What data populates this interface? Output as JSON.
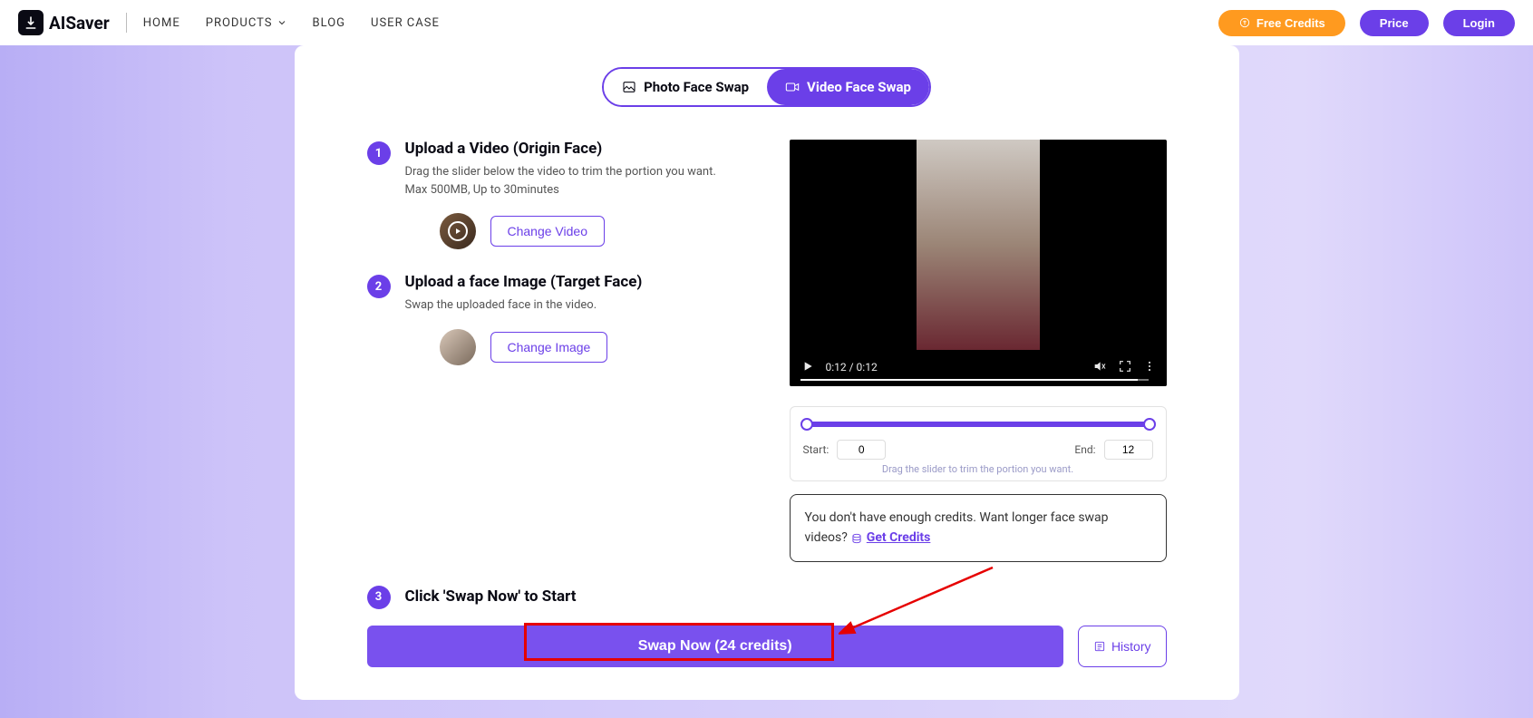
{
  "header": {
    "logo_text": "AISaver",
    "nav": {
      "home": "HOME",
      "products": "PRODUCTS",
      "blog": "BLOG",
      "usercase": "USER CASE"
    },
    "free_credits": "Free Credits",
    "price": "Price",
    "login": "Login"
  },
  "tabs": {
    "photo": "Photo Face Swap",
    "video": "Video Face Swap"
  },
  "steps": {
    "s1": {
      "num": "1",
      "title": "Upload a Video (Origin Face)",
      "desc1": "Drag the slider below the video to trim the portion you want.",
      "desc2": "Max 500MB, Up to 30minutes",
      "change": "Change Video"
    },
    "s2": {
      "num": "2",
      "title": "Upload a face Image (Target Face)",
      "desc": "Swap the uploaded face in the video.",
      "change": "Change Image"
    },
    "s3": {
      "num": "3",
      "title": "Click 'Swap Now' to Start"
    }
  },
  "video": {
    "time": "0:12 / 0:12"
  },
  "trim": {
    "start_label": "Start:",
    "start_value": "0",
    "end_label": "End:",
    "end_value": "12",
    "hint": "Drag the slider to trim the portion you want."
  },
  "msg": {
    "text": "You don't have enough credits. Want longer face swap videos? ",
    "link": "Get Credits"
  },
  "actions": {
    "swap": "Swap Now (24 credits)",
    "history": "History"
  }
}
